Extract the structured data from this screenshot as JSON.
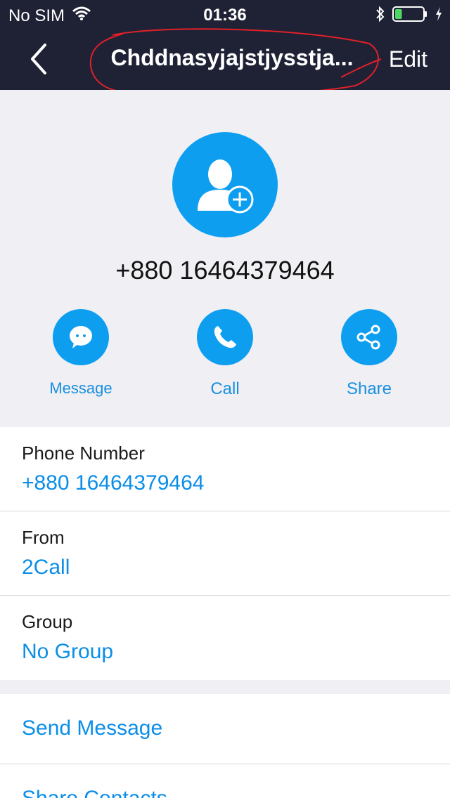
{
  "status": {
    "carrier": "No SIM",
    "time": "01:36",
    "battery_percent": 25
  },
  "nav": {
    "title": "Chddnasyjajstjysstja...",
    "edit_label": "Edit"
  },
  "contact": {
    "number": "+880 16464379464"
  },
  "actions": [
    {
      "label": "Message",
      "icon": "chat-bubble-icon"
    },
    {
      "label": "Call",
      "icon": "phone-icon"
    },
    {
      "label": "Share",
      "icon": "share-icon"
    }
  ],
  "details": [
    {
      "key": "Phone Number",
      "value": "+880 16464379464"
    },
    {
      "key": "From",
      "value": "2Call"
    },
    {
      "key": "Group",
      "value": "No Group"
    }
  ],
  "menu": [
    {
      "label": "Send Message"
    },
    {
      "label": "Share Contacts"
    }
  ],
  "colors": {
    "navbar": "#1f2235",
    "accent": "#0d9ef0",
    "link": "#0a8ee8",
    "annotation": "#e0202a"
  }
}
